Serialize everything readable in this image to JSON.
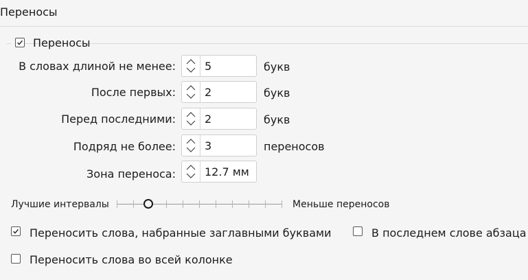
{
  "panel": {
    "title": "Переносы"
  },
  "hyphenation": {
    "enabled_label": "Переносы",
    "enabled": true
  },
  "fields": [
    {
      "label": "В словах длиной не менее:",
      "value": "5",
      "unit": "букв"
    },
    {
      "label": "После первых:",
      "value": "2",
      "unit": "букв"
    },
    {
      "label": "Перед последними:",
      "value": "2",
      "unit": "букв"
    },
    {
      "label": "Подряд не более:",
      "value": "3",
      "unit": "переносов"
    },
    {
      "label": "Зона переноса:",
      "value": "12.7 мм",
      "unit": ""
    }
  ],
  "slider": {
    "left_label": "Лучшие интервалы",
    "right_label": "Меньше переносов",
    "position_fraction": 0.19
  },
  "options": {
    "caps_label": "Переносить слова, набранные заглавными буквами",
    "caps_checked": true,
    "last_word_label": "В последнем слове абзаца",
    "last_word_checked": false,
    "whole_column_label": "Переносить слова во всей колонке",
    "whole_column_checked": false
  },
  "icons": {
    "checkbox_checked": "checkmark-icon",
    "spinner": "spinner-arrows-icon"
  }
}
